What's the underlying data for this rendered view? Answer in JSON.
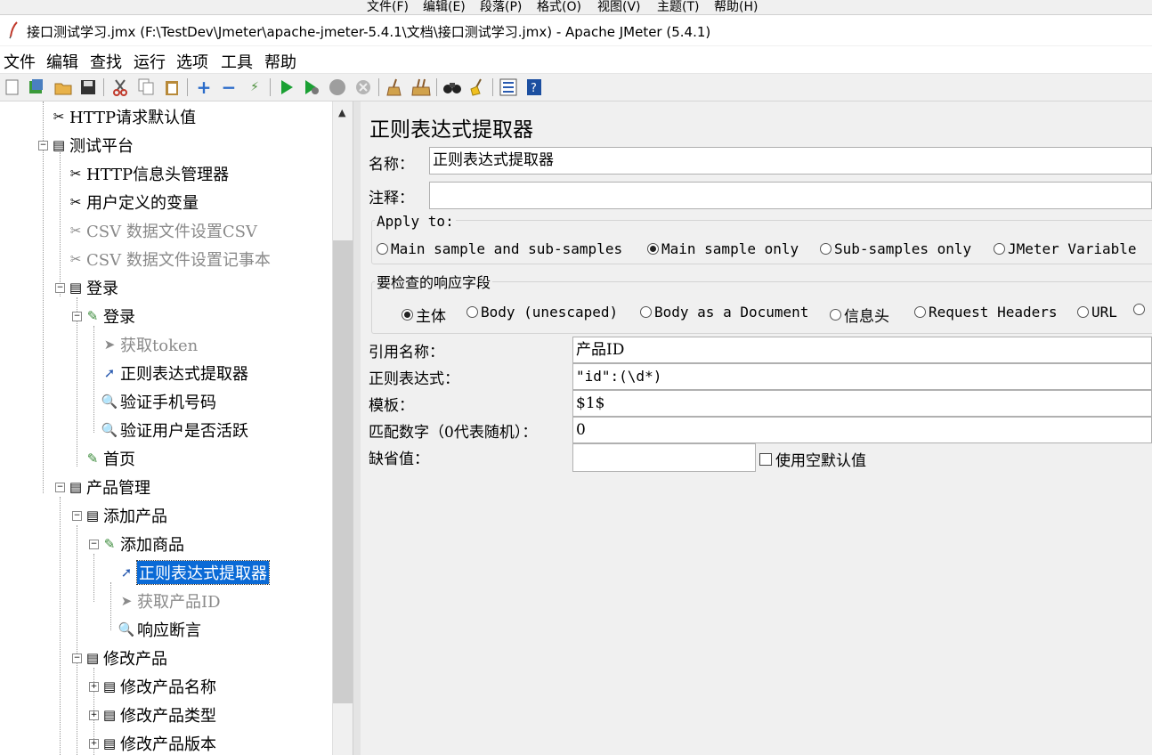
{
  "notepad_menu": [
    "文件(F)",
    "编辑(E)",
    "段落(P)",
    "格式(O)",
    "视图(V)",
    "主题(T)",
    "帮助(H)"
  ],
  "window": {
    "title": "接口测试学习.jmx (F:\\TestDev\\Jmeter\\apache-jmeter-5.4.1\\文档\\接口测试学习.jmx) - Apache JMeter (5.4.1)"
  },
  "menu": [
    "文件",
    "编辑",
    "查找",
    "运行",
    "选项",
    "工具",
    "帮助"
  ],
  "toolbar_icons": [
    "new-icon",
    "templates-icon",
    "open-icon",
    "save-icon",
    "cut-icon",
    "copy-icon",
    "paste-icon",
    "expand-icon",
    "collapse-icon",
    "toggle-icon",
    "start-icon",
    "start-no-pause-icon",
    "stop-icon",
    "shutdown-icon",
    "clear-icon",
    "clear-all-icon",
    "search-icon",
    "reset-search-icon",
    "function-helper-icon",
    "help-icon"
  ],
  "tree": [
    {
      "label": "HTTP请求默认值",
      "icon": "config-icon",
      "disabled": false
    },
    {
      "label": "测试平台",
      "icon": "controller-icon",
      "disabled": false
    },
    {
      "label": "HTTP信息头管理器",
      "icon": "config-icon",
      "disabled": false
    },
    {
      "label": "用户定义的变量",
      "icon": "config-icon",
      "disabled": false
    },
    {
      "label": "CSV 数据文件设置CSV",
      "icon": "config-icon",
      "disabled": true
    },
    {
      "label": "CSV 数据文件设置记事本",
      "icon": "config-icon",
      "disabled": true
    },
    {
      "label": "登录",
      "icon": "controller-icon",
      "disabled": false
    },
    {
      "label": "登录",
      "icon": "sampler-icon",
      "disabled": false
    },
    {
      "label": "获取token",
      "icon": "extractor-icon",
      "disabled": true
    },
    {
      "label": "正则表达式提取器",
      "icon": "extractor-icon",
      "disabled": false
    },
    {
      "label": "验证手机号码",
      "icon": "assertion-icon",
      "disabled": false
    },
    {
      "label": "验证用户是否活跃",
      "icon": "assertion-icon",
      "disabled": false
    },
    {
      "label": "首页",
      "icon": "sampler-icon",
      "disabled": false
    },
    {
      "label": "产品管理",
      "icon": "controller-icon",
      "disabled": false
    },
    {
      "label": "添加产品",
      "icon": "controller-icon",
      "disabled": false
    },
    {
      "label": "添加商品",
      "icon": "sampler-icon",
      "disabled": false
    },
    {
      "label": "正则表达式提取器",
      "icon": "extractor-icon",
      "disabled": false,
      "selected": true
    },
    {
      "label": "获取产品ID",
      "icon": "extractor-icon",
      "disabled": true
    },
    {
      "label": "响应断言",
      "icon": "assertion-icon",
      "disabled": false
    },
    {
      "label": "修改产品",
      "icon": "controller-icon",
      "disabled": false
    },
    {
      "label": "修改产品名称",
      "icon": "controller-icon",
      "disabled": false
    },
    {
      "label": "修改产品类型",
      "icon": "controller-icon",
      "disabled": false
    },
    {
      "label": "修改产品版本",
      "icon": "controller-icon",
      "disabled": false
    }
  ],
  "panel": {
    "heading": "正则表达式提取器",
    "name_label": "名称：",
    "name_value": "正则表达式提取器",
    "comment_label": "注释：",
    "comment_value": "",
    "apply_to": {
      "legend": "Apply to:",
      "options": [
        "Main sample and sub-samples",
        "Main sample only",
        "Sub-samples only",
        "JMeter Variable"
      ],
      "selected": "Main sample only"
    },
    "field_to_check": {
      "legend": "要检查的响应字段",
      "options": [
        "主体",
        "Body (unescaped)",
        "Body as a Document",
        "信息头",
        "Request Headers",
        "URL"
      ],
      "selected": "主体"
    },
    "ref_name_label": "引用名称：",
    "ref_name_value": "产品ID",
    "regex_label": "正则表达式：",
    "regex_value": "\"id\":(\\d*)",
    "template_label": "模板：",
    "template_value": "$1$",
    "match_no_label": "匹配数字（0代表随机）：",
    "match_no_value": "0",
    "default_label": "缺省值：",
    "default_value": "",
    "use_empty_default_label": "使用空默认值",
    "use_empty_default_checked": false
  }
}
